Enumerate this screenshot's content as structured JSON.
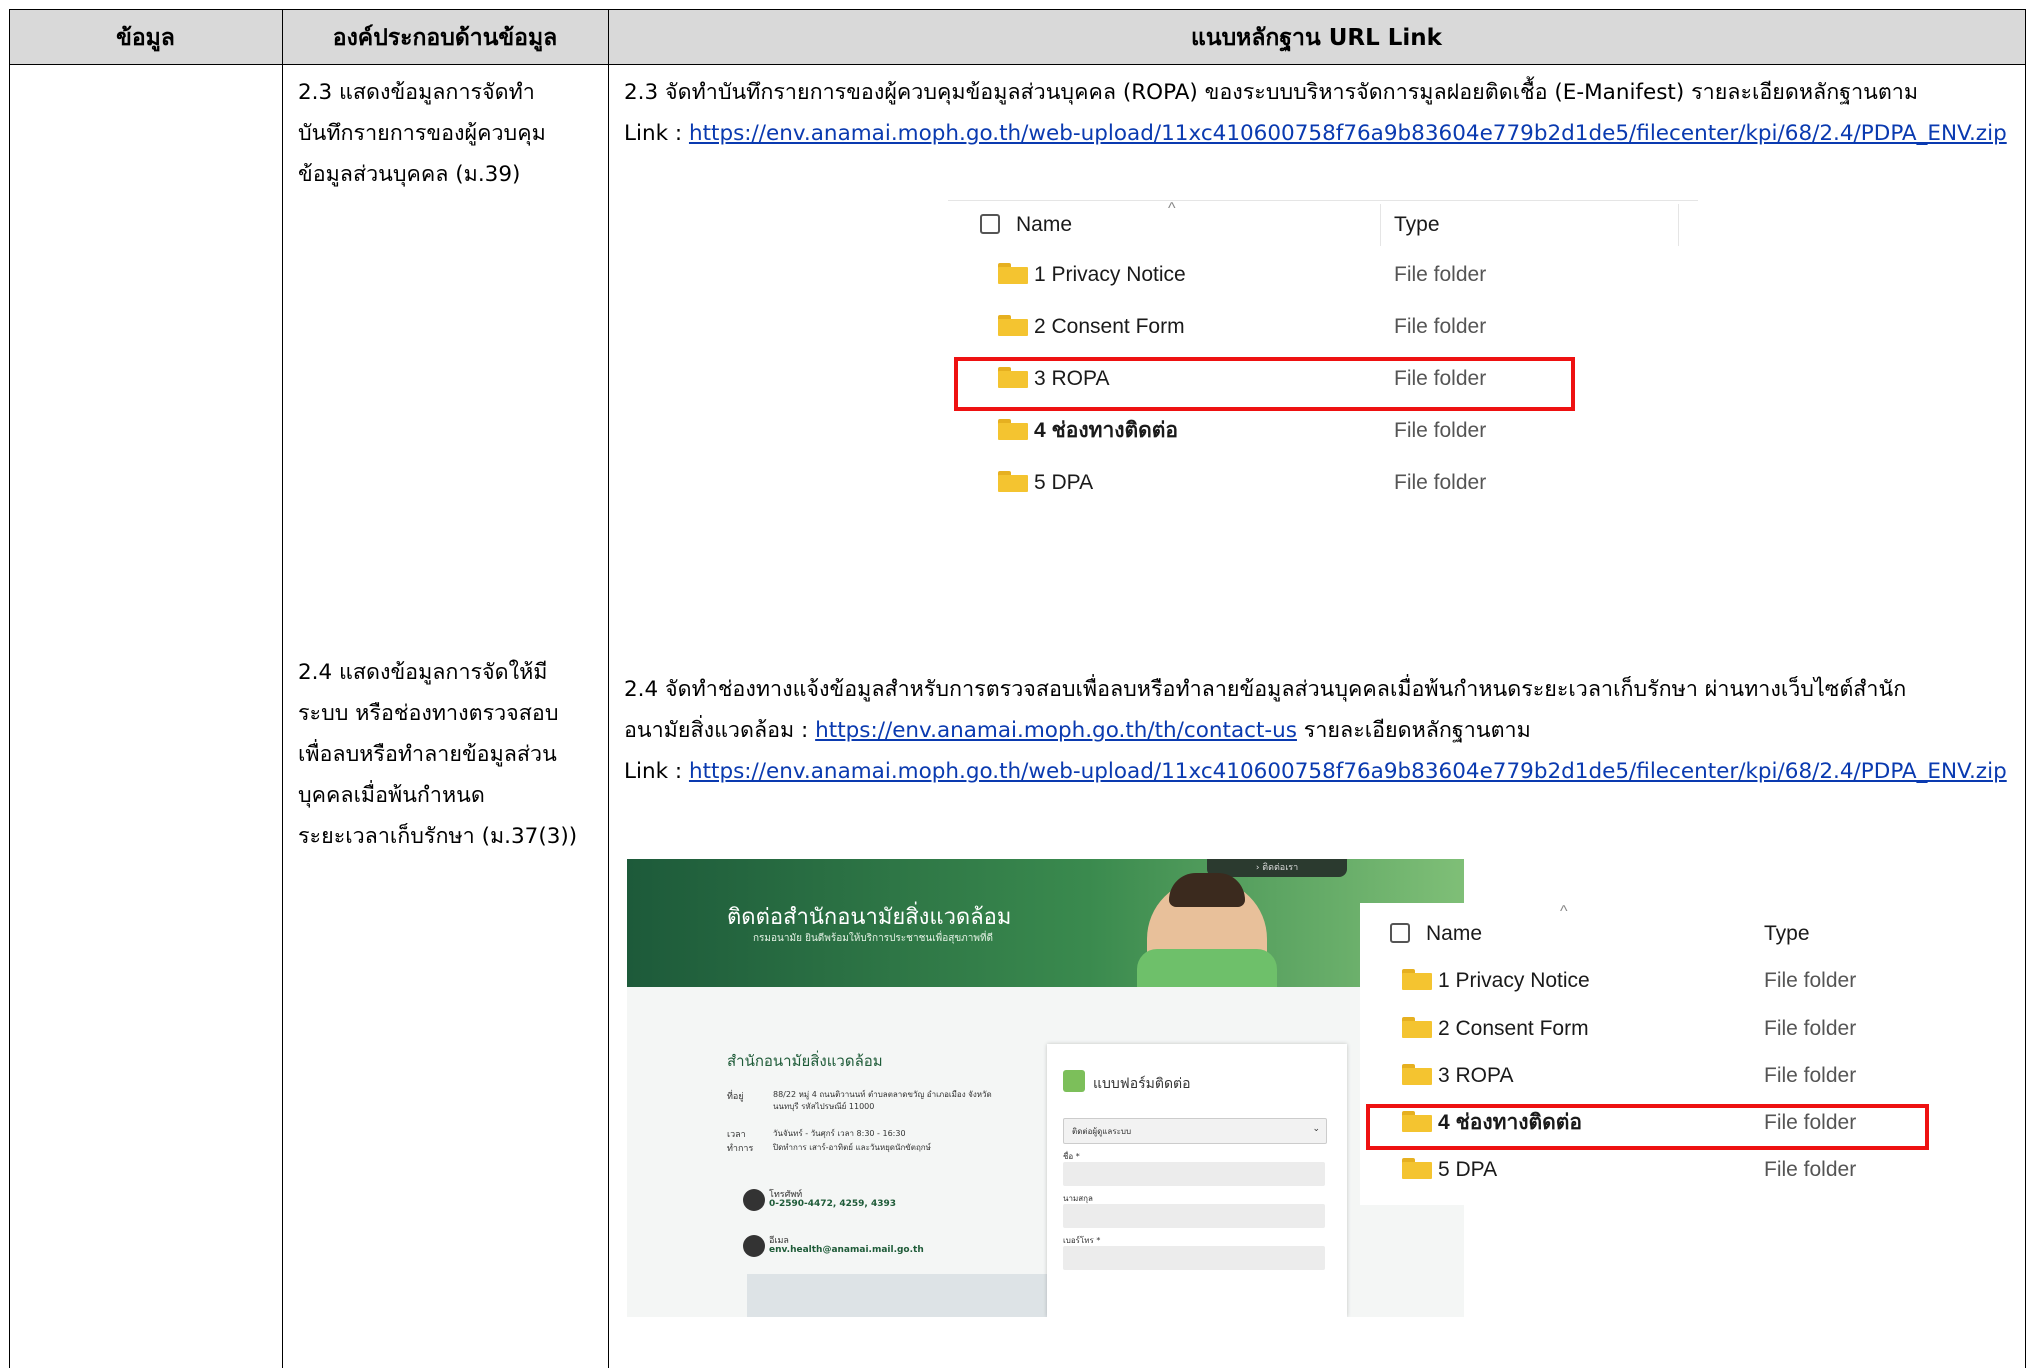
{
  "table": {
    "headers": [
      "ข้อมูล",
      "องค์ประกอบด้านข้อมูล",
      "แนบหลักฐาน URL Link"
    ],
    "row1": {
      "component_lines": [
        "2.3 แสดงข้อมูลการจัดทำ",
        "บันทึกรายการของผู้ควบคุม",
        "ข้อมูลส่วนบุคคล (ม.39)"
      ],
      "evidence_line1": "2.3 จัดทำบันทึกรายการของผู้ควบคุมข้อมูลส่วนบุคคล (ROPA) ของระบบบริหารจัดการมูลฝอยติดเชื้อ (E-Manifest) รายละเอียดหลักฐานตาม",
      "link_prefix": "Link : ",
      "link_url": "https://env.anamai.moph.go.th/web-upload/11xc410600758f76a9b83604e779b2d1de5/filecenter/kpi/68/2.4/PDPA_ENV.zip"
    },
    "row2": {
      "component_lines": [
        "2.4 แสดงข้อมูลการจัดให้มี",
        "ระบบ หรือช่องทางตรวจสอบ",
        "เพื่อลบหรือทำลายข้อมูลส่วน",
        "บุคคลเมื่อพ้นกำหนด",
        "ระยะเวลาเก็บรักษา (ม.37(3))"
      ],
      "evidence_line1": "2.4 จัดทำช่องทางแจ้งข้อมูลสำหรับการตรวจสอบเพื่อลบหรือทำลายข้อมูลส่วนบุคคลเมื่อพ้นกำหนดระยะเวลาเก็บรักษา ผ่านทางเว็บไซต์สำนัก",
      "evidence_line2_prefix": "อนามัยสิ่งแวดล้อม : ",
      "contact_url": "https://env.anamai.moph.go.th/th/contact-us",
      "evidence_line2_suffix": " รายละเอียดหลักฐานตาม",
      "link_prefix": "Link : ",
      "link_url": "https://env.anamai.moph.go.th/web-upload/11xc410600758f76a9b83604e779b2d1de5/filecenter/kpi/68/2.4/PDPA_ENV.zip"
    }
  },
  "explorer": {
    "col_name": "Name",
    "col_type": "Type",
    "items": [
      {
        "name": "1 Privacy Notice",
        "type": "File folder"
      },
      {
        "name": "2 Consent Form",
        "type": "File folder"
      },
      {
        "name": "3 ROPA",
        "type": "File folder"
      },
      {
        "name": "4 ช่องทางติดต่อ",
        "type": "File folder"
      },
      {
        "name": "5 DPA",
        "type": "File folder"
      }
    ],
    "highlight_color": "#e11111"
  },
  "website": {
    "nav_text": "› ติดต่อเรา",
    "banner_title": "ติดต่อสำนักอนามัยสิ่งแวดล้อม",
    "banner_sub": "กรมอนามัย ยินดีพร้อมให้บริการประชาชนเพื่อสุขภาพที่ดี",
    "org_name": "สำนักอนามัยสิ่งแวดล้อม",
    "addr_label": "ที่อยู่",
    "addr": "88/22 หมู่ 4 ถนนติวานนท์ ตำบลตลาดขวัญ อำเภอเมือง จังหวัดนนทบุรี รหัสไปรษณีย์ 11000",
    "time_label": "เวลา",
    "time": "วันจันทร์ - วันศุกร์ เวลา 8:30 - 16:30",
    "closed_label": "ทำการ",
    "closed": "ปิดทำการ เสาร์-อาทิตย์ และวันหยุดนักขัตฤกษ์",
    "phone_label": "โทรศัพท์",
    "phone": "0-2590-4472, 4259, 4393",
    "email_label": "อีเมล",
    "email": "env.health@anamai.mail.go.th",
    "form_title": "แบบฟอร์มติดต่อ",
    "select_placeholder": "ติดต่อผู้ดูแลระบบ",
    "field_name": "ชื่อ *",
    "field_surname": "นามสกุล",
    "field_phone": "เบอร์โทร *"
  }
}
